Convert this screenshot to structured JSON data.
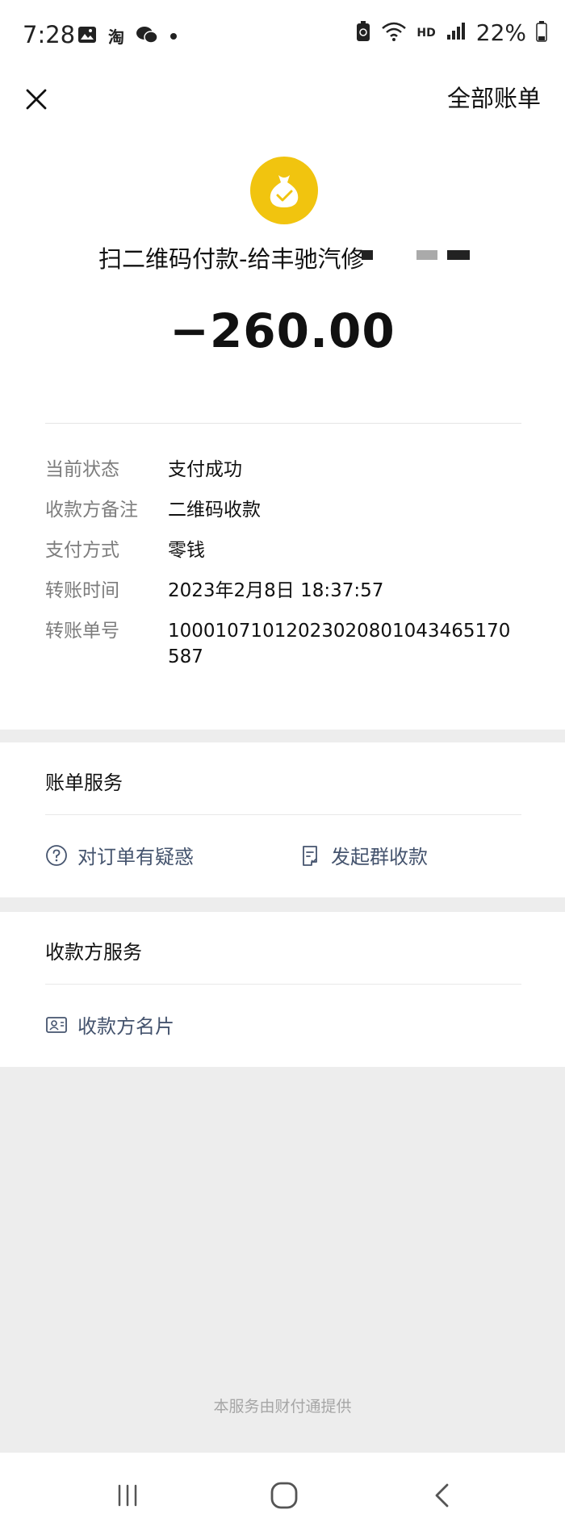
{
  "status_bar": {
    "time": "7:28",
    "icons_left": [
      "gallery-icon",
      "taobao-icon",
      "wechat-icon",
      "dot-icon"
    ],
    "taobao_glyph": "淘",
    "hd_label": "HD",
    "battery": "22%"
  },
  "top_bar": {
    "all_bills_label": "全部账单"
  },
  "transaction": {
    "merchant": "扫二维码付款-给丰驰汽修",
    "amount": "−260.00",
    "details": [
      {
        "label": "当前状态",
        "value": "支付成功"
      },
      {
        "label": "收款方备注",
        "value": "二维码收款"
      },
      {
        "label": "支付方式",
        "value": "零钱"
      },
      {
        "label": "转账时间",
        "value": "2023年2月8日 18:37:57"
      },
      {
        "label": "转账单号",
        "value": "10001071012023020801043465170587"
      }
    ]
  },
  "bill_service": {
    "title": "账单服务",
    "question_label": "对订单有疑惑",
    "group_collect_label": "发起群收款"
  },
  "payee_service": {
    "title": "收款方服务",
    "payee_card_label": "收款方名片"
  },
  "footer": {
    "note": "本服务由财付通提供"
  },
  "colors": {
    "accent_yellow": "#f1c40f",
    "link_text": "#45546e",
    "label_gray": "#7d7d7d",
    "background": "#ededed"
  }
}
